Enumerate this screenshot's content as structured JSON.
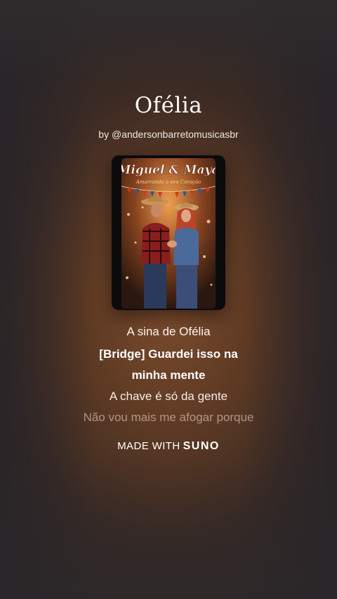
{
  "song": {
    "title": "Ofélia",
    "byline": "by @andersonbarretomusicasbr"
  },
  "cover": {
    "art_title": "Miguel & Maya",
    "art_subtitle": "Amarrando o seu Coração"
  },
  "lyrics": [
    {
      "text": "A sina de Ofélia",
      "state": "past"
    },
    {
      "text": "[Bridge] Guardei isso na",
      "state": "current"
    },
    {
      "text": "minha mente",
      "state": "current"
    },
    {
      "text": "A chave é só da gente",
      "state": "next"
    },
    {
      "text": "Não vou mais me afogar porque",
      "state": "upcoming"
    }
  ],
  "footer": {
    "made_with_label": "MADE WITH",
    "brand": "SUNO"
  },
  "colors": {
    "background_warm": "#7a4a2c",
    "background_dark": "#2c2628",
    "text": "#ffffff"
  }
}
